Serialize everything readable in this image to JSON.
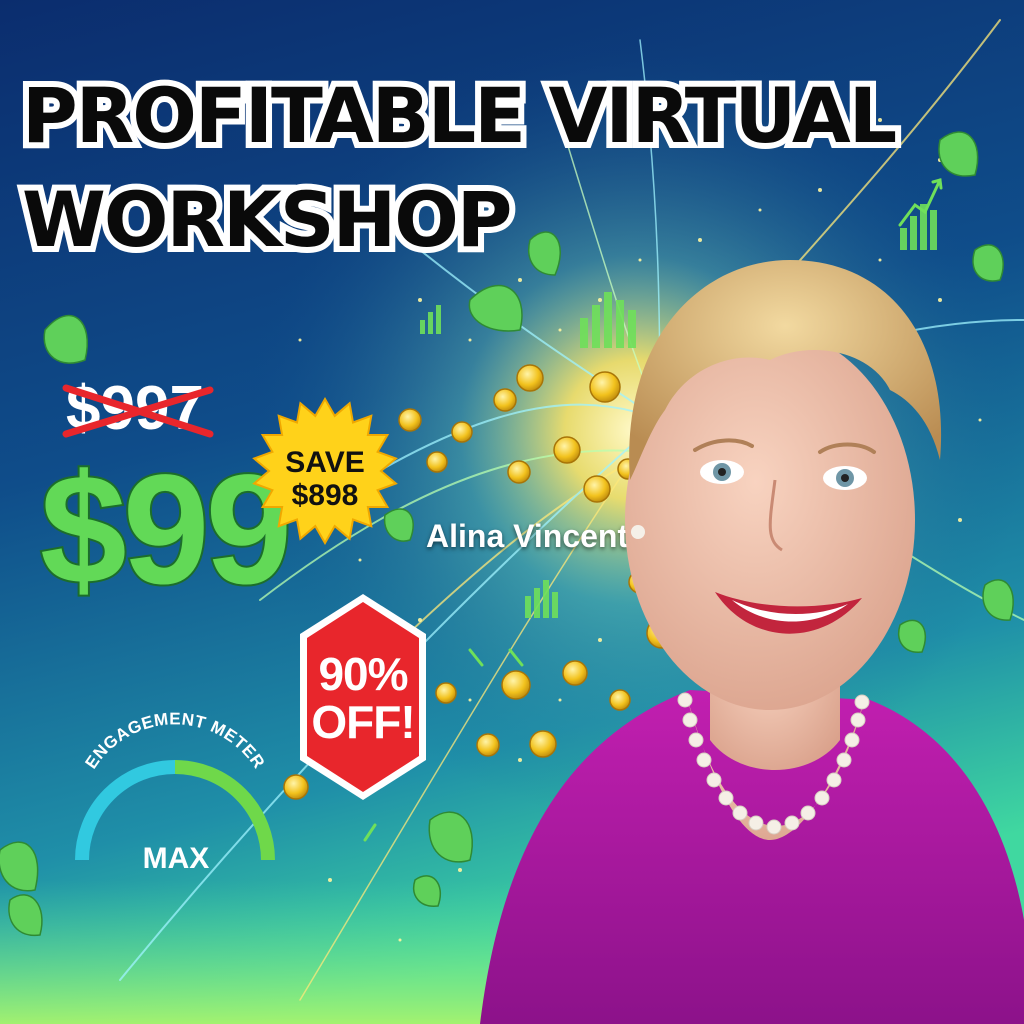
{
  "title": {
    "line1": "PROFITABLE VIRTUAL",
    "line2": "WORKSHOP"
  },
  "pricing": {
    "old_price": "$997",
    "new_price": "$99"
  },
  "save_badge": {
    "line1": "SAVE",
    "line2": "$898"
  },
  "discount_badge": {
    "line1": "90%",
    "line2": "OFF!"
  },
  "engagement_meter": {
    "label": "ENGAGEMENT METER",
    "value_text": "MAX",
    "level": 1.0
  },
  "speaker": {
    "name": "Alina Vincent"
  },
  "colors": {
    "background_top": "#0c2f73",
    "background_bottom": "#33c8a8",
    "price_green": "#62d957",
    "badge_yellow": "#ffd21a",
    "badge_red": "#e8262c",
    "meter_teal": "#31c9e0",
    "meter_green": "#6fd84a",
    "dress_magenta": "#b21ca3",
    "strike_red": "#e8262c"
  },
  "icons": [
    "leaf-icon",
    "coin-icon",
    "growth-chart-icon",
    "trend-arrow-icon"
  ]
}
